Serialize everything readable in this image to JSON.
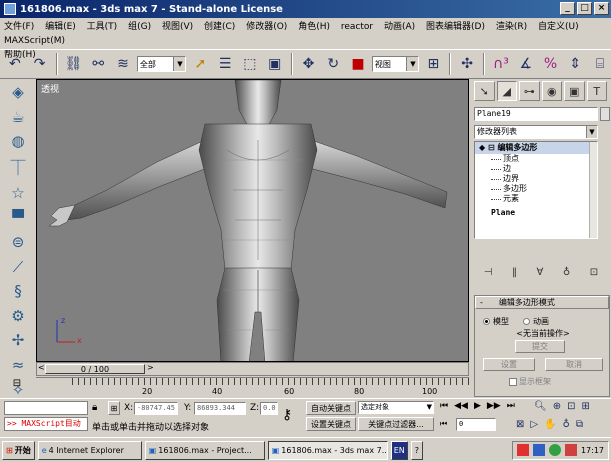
{
  "window": {
    "title": "161806.max - 3ds max 7 - Stand-alone License",
    "btn_min": "_",
    "btn_max": "□",
    "btn_close": "×"
  },
  "menu": [
    "文件(F)",
    "编辑(E)",
    "工具(T)",
    "组(G)",
    "视图(V)",
    "创建(C)",
    "修改器(O)",
    "角色(H)",
    "reactor",
    "动画(A)",
    "图表编辑器(D)",
    "渲染(R)",
    "自定义(U)",
    "MAXScript(M)",
    "帮助(H)"
  ],
  "toolbar": {
    "selection_filter": "全部",
    "ref_coord": "视图",
    "icons": [
      "undo-icon",
      "redo-icon",
      "link-icon",
      "unlink-icon",
      "bind-space-warp-icon",
      "select-icon",
      "select-by-name-icon",
      "region-select-icon",
      "window-crossing-icon",
      "move-icon",
      "rotate-icon",
      "scale-icon",
      "mirror-icon",
      "align-icon",
      "snap-icon",
      "angle-snap-icon",
      "percent-snap-icon",
      "spinner-snap-icon",
      "named-selection-icon"
    ]
  },
  "viewport": {
    "label": "透视"
  },
  "command_panel": {
    "object_name": "Plane19",
    "modifier_list": "修改器列表",
    "stack": {
      "root": "编辑多边形",
      "subobjects": [
        "顶点",
        "边",
        "边界",
        "多边形",
        "元素"
      ],
      "base": "Plane"
    },
    "rollout": {
      "title": "编辑多边形模式",
      "mode_model": "模型",
      "mode_anim": "动画",
      "no_op": "<无当前操作>",
      "commit": "提交",
      "settings": "设置",
      "cancel": "取消",
      "show_cage": "显示框架"
    }
  },
  "timeline": {
    "slider": "0 / 100",
    "ticks": [
      "20",
      "40",
      "60",
      "80",
      "100"
    ]
  },
  "status": {
    "maxscript": ">> MAXScript目动",
    "prompt": "单击或单击并拖动以选择对象",
    "x_label": "X:",
    "x_value": "-80747.45",
    "y_label": "Y:",
    "y_value": "86893.344",
    "z_label": "Z:",
    "z_value": "0.0",
    "auto_key": "自动关键点",
    "set_key": "设置关键点",
    "selected": "选定对象",
    "key_filters": "关键点过滤器...",
    "frame": "0"
  },
  "taskbar": {
    "start": "开始",
    "ie": "4 Internet Explorer",
    "task1": "161806.max - Project...",
    "task2": "161806.max - 3ds max 7...",
    "lang": "EN",
    "clock": "17:17"
  }
}
